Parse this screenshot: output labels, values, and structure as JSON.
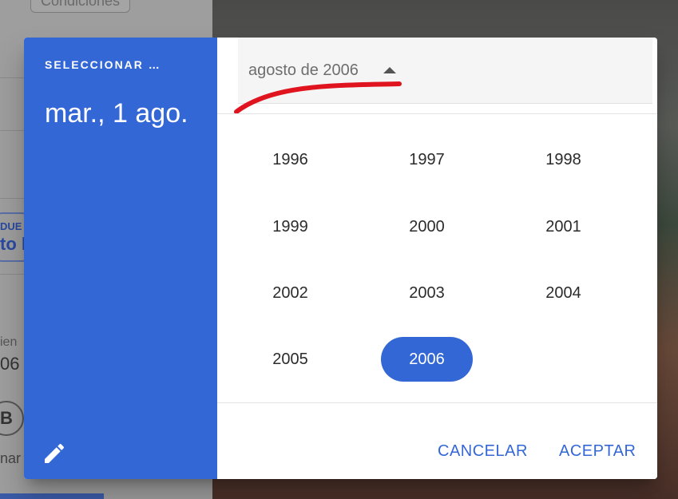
{
  "background": {
    "chip_label": "Condiciones",
    "partial_label_1": "DUE",
    "partial_blue": "to l",
    "partial_label_2": "ien",
    "partial_value": "06",
    "avatar_letter": "B",
    "partial_label_3": "nar"
  },
  "dialog": {
    "header": {
      "overline": "SELECCIONAR …",
      "selected_date": "mar., 1 ago."
    },
    "month_selector": {
      "label": "agosto de 2006"
    },
    "years": [
      "1996",
      "1997",
      "1998",
      "1999",
      "2000",
      "2001",
      "2002",
      "2003",
      "2004",
      "2005",
      "2006"
    ],
    "selected_year": "2006",
    "actions": {
      "cancel": "CANCELAR",
      "accept": "ACEPTAR"
    }
  },
  "colors": {
    "accent": "#3467d6",
    "annotation": "#e0141e"
  }
}
